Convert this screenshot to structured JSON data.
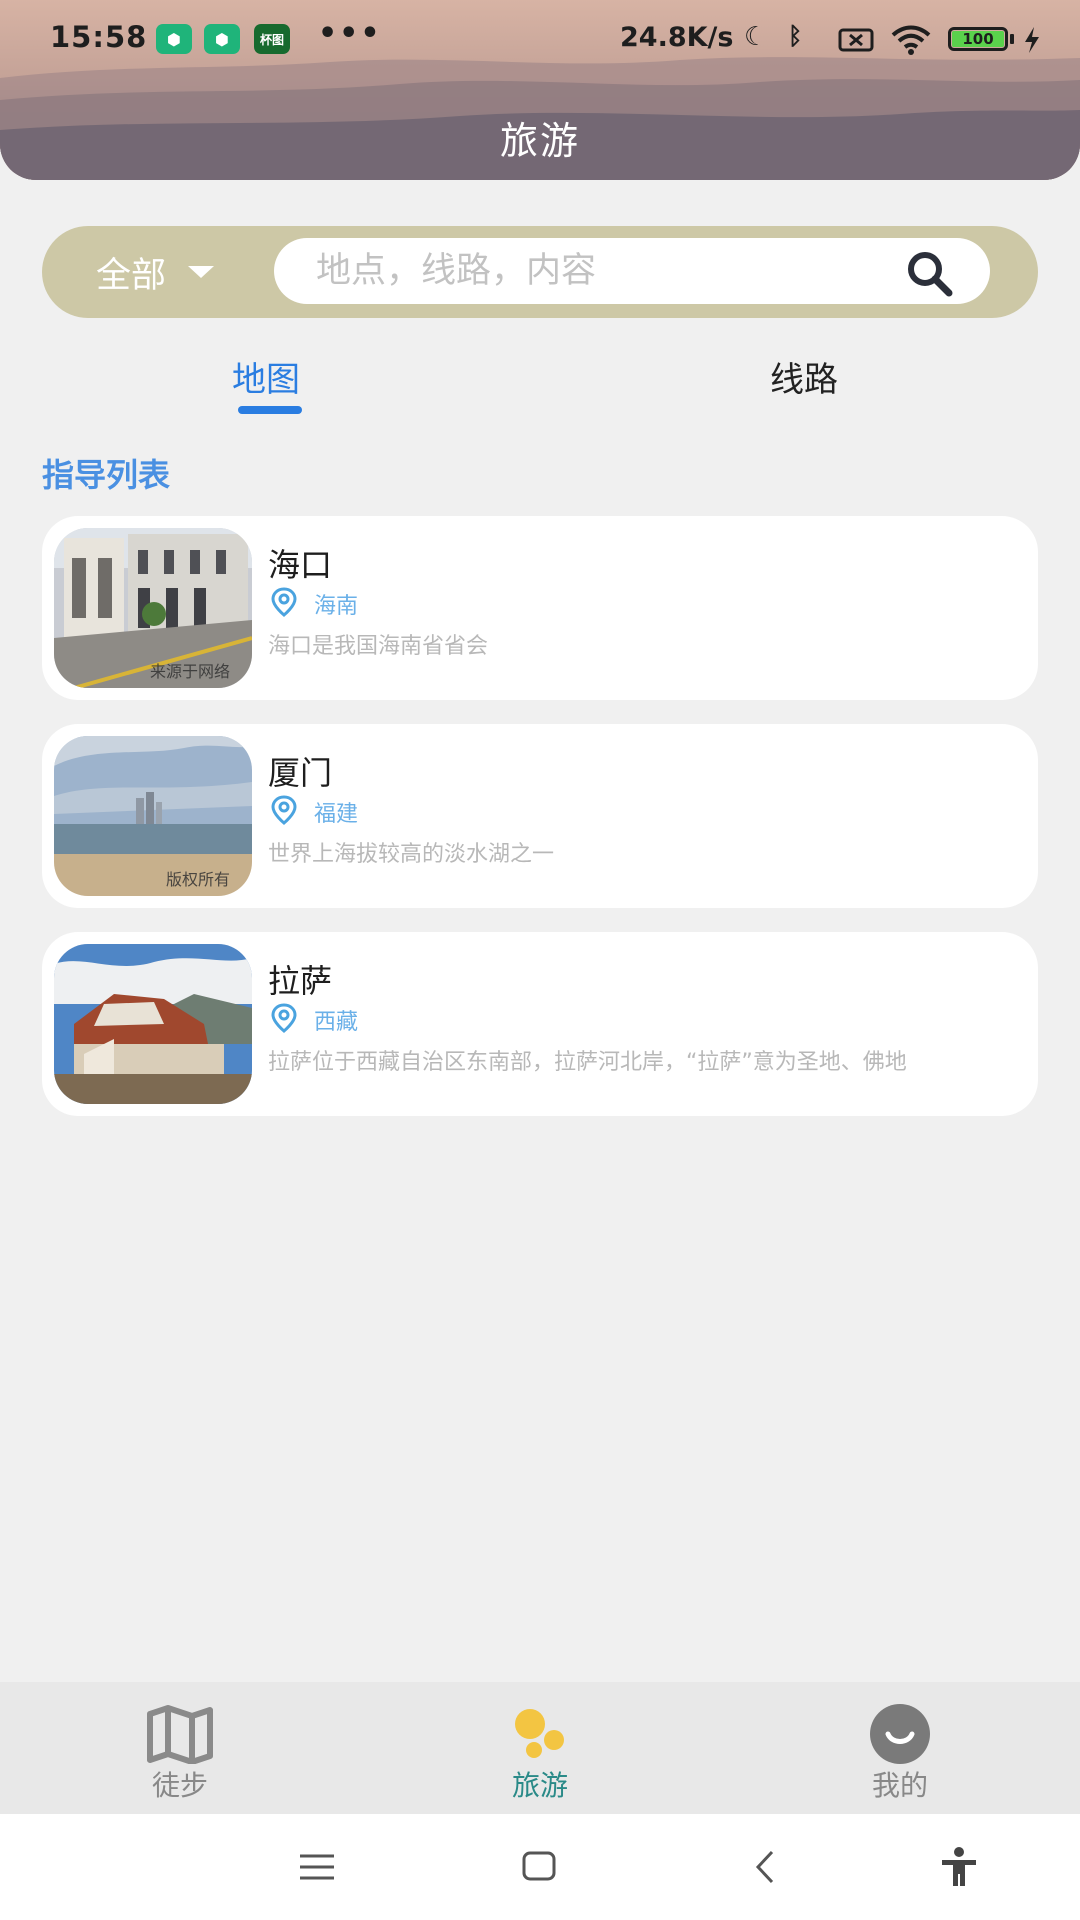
{
  "status_bar": {
    "time": "15:58",
    "notif_badges": [
      "",
      "",
      "杯图"
    ],
    "more": "•••",
    "net_speed": "24.8K/s",
    "battery": "100"
  },
  "header": {
    "title": "旅游"
  },
  "search": {
    "filter_label": "全部",
    "placeholder": "地点，线路，内容"
  },
  "tabs": [
    {
      "label": "地图",
      "active": true
    },
    {
      "label": "线路",
      "active": false
    }
  ],
  "section_title": "指导列表",
  "guides": [
    {
      "name": "海口",
      "province": "海南",
      "description": "海口是我国海南省省会",
      "watermark": "来源于网络",
      "image": "street-photo"
    },
    {
      "name": "厦门",
      "province": "福建",
      "description": "世界上海拔较高的淡水湖之一",
      "watermark": "版权所有",
      "image": "beach-photo"
    },
    {
      "name": "拉萨",
      "province": "西藏",
      "description": "拉萨位于西藏自治区东南部，拉萨河北岸，“拉萨”意为圣地、佛地",
      "watermark": "",
      "image": "palace-photo"
    }
  ],
  "bottom_nav": [
    {
      "label": "徒步",
      "icon": "map-icon",
      "active": false
    },
    {
      "label": "旅游",
      "icon": "travel-dots-icon",
      "active": true
    },
    {
      "label": "我的",
      "icon": "smile-face-icon",
      "active": false
    }
  ],
  "colors": {
    "accent_blue": "#2a7de1",
    "search_bar_bg": "#cdc8a6",
    "active_nav": "#2a8a88",
    "location_blue": "#6ab0e8"
  }
}
